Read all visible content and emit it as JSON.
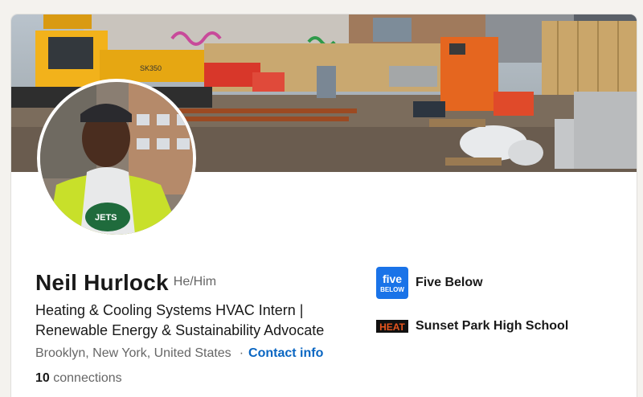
{
  "profile": {
    "name": "Neil Hurlock",
    "pronouns": "He/Him",
    "headline": "Heating & Cooling Systems HVAC Intern | Renewable Energy & Sustainability Advocate",
    "location": "Brooklyn, New York, United States",
    "separator": "·",
    "contact_info": "Contact info",
    "connections_count": "10",
    "connections_label": "connections"
  },
  "highlights": [
    {
      "name": "Five Below",
      "logo_text_1": "five",
      "logo_text_2": "BELOW",
      "logo_color": "#1a73e8"
    },
    {
      "name": "Sunset Park High School",
      "logo_text": "HEAT",
      "logo_color": "#111111"
    }
  ],
  "colors": {
    "link": "#0a66c2",
    "text_primary": "#191919",
    "text_secondary": "#666666"
  }
}
